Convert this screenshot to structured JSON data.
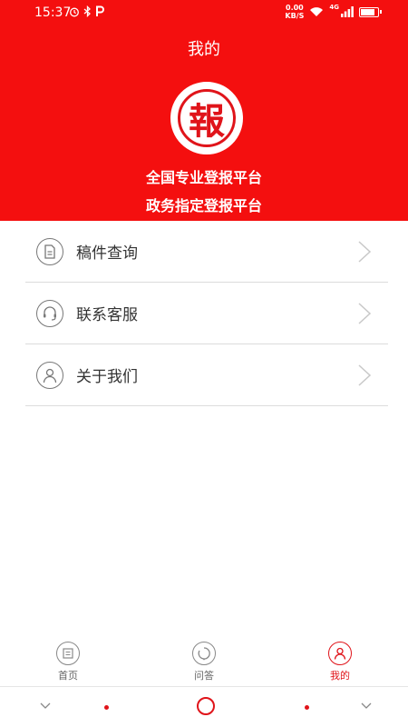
{
  "status_bar": {
    "time": "15:37",
    "left_icons": [
      "alarm-icon",
      "bluetooth-icon",
      "parking-icon"
    ],
    "net_speed_value": "0.00",
    "net_speed_unit": "KB/S",
    "network_label": "4G",
    "battery_level": 0.9
  },
  "header": {
    "title": "我的",
    "logo_char": "報",
    "slogan_1": "全国专业登报平台",
    "slogan_2": "政务指定登报平台",
    "background_color": "#f40f0f"
  },
  "menu": {
    "items": [
      {
        "label": "稿件查询",
        "icon": "document-icon"
      },
      {
        "label": "联系客服",
        "icon": "headset-icon"
      },
      {
        "label": "关于我们",
        "icon": "user-icon"
      }
    ]
  },
  "bottom_nav": {
    "items": [
      {
        "label": "首页",
        "icon": "home-icon",
        "active": false
      },
      {
        "label": "问答",
        "icon": "qa-icon",
        "active": false
      },
      {
        "label": "我的",
        "icon": "profile-icon",
        "active": true
      }
    ],
    "active_color": "#e0141a"
  }
}
